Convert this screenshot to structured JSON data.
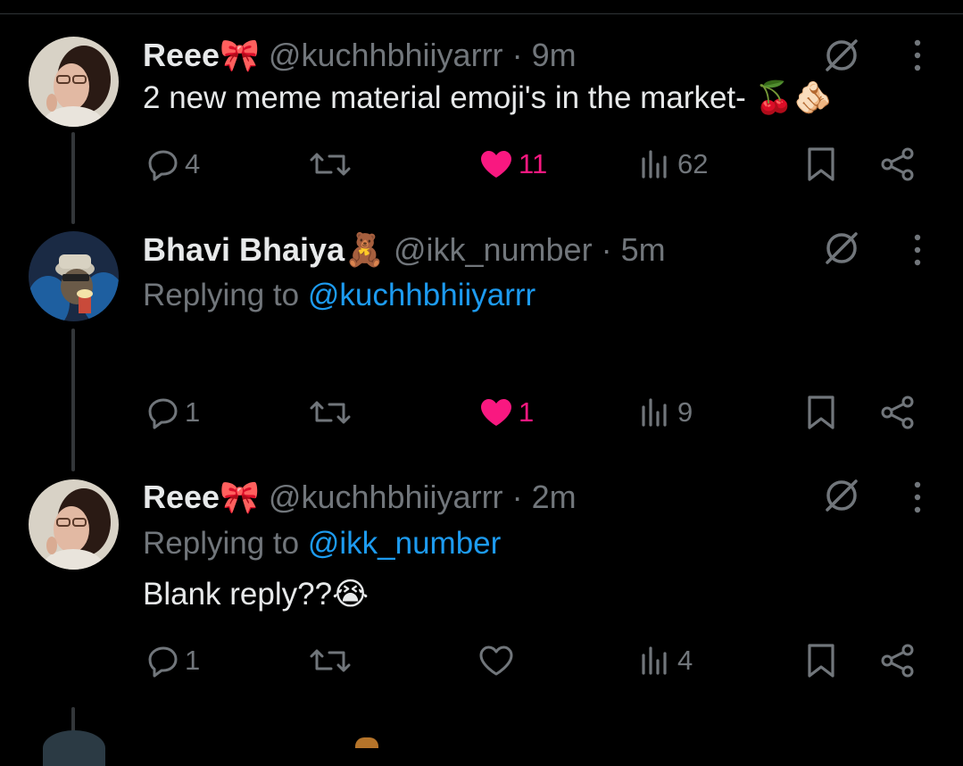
{
  "tweets": [
    {
      "name": "Reee",
      "name_emoji": "🎀",
      "handle": "@kuchhbhiiyarrr",
      "separator": "·",
      "time": "9m",
      "replying_prefix": "",
      "replying_to": "",
      "text": "2 new meme material emoji's in the market- 🍒🫵🏻",
      "replies": "4",
      "reposts": "",
      "likes": "11",
      "liked": true,
      "views": "62"
    },
    {
      "name": "Bhavi Bhaiya",
      "name_emoji": "🧸",
      "handle": "@ikk_number",
      "separator": "·",
      "time": "5m",
      "replying_prefix": "Replying to",
      "replying_to": "@kuchhbhiiyarrr",
      "text": "",
      "replies": "1",
      "reposts": "",
      "likes": "1",
      "liked": true,
      "views": "9"
    },
    {
      "name": "Reee",
      "name_emoji": "🎀",
      "handle": "@kuchhbhiiyarrr",
      "separator": "·",
      "time": "2m",
      "replying_prefix": "Replying to",
      "replying_to": "@ikk_number",
      "text": "Blank reply??😭",
      "replies": "1",
      "reposts": "",
      "likes": "",
      "liked": false,
      "views": "4"
    }
  ],
  "colors": {
    "background": "#000000",
    "text": "#e7e9ea",
    "muted": "#71767b",
    "link": "#1d9bf0",
    "like": "#f91880"
  },
  "icons": [
    "reply-icon",
    "repost-icon",
    "heart-icon",
    "views-icon",
    "bookmark-icon",
    "share-icon",
    "grok-icon",
    "more-icon"
  ]
}
